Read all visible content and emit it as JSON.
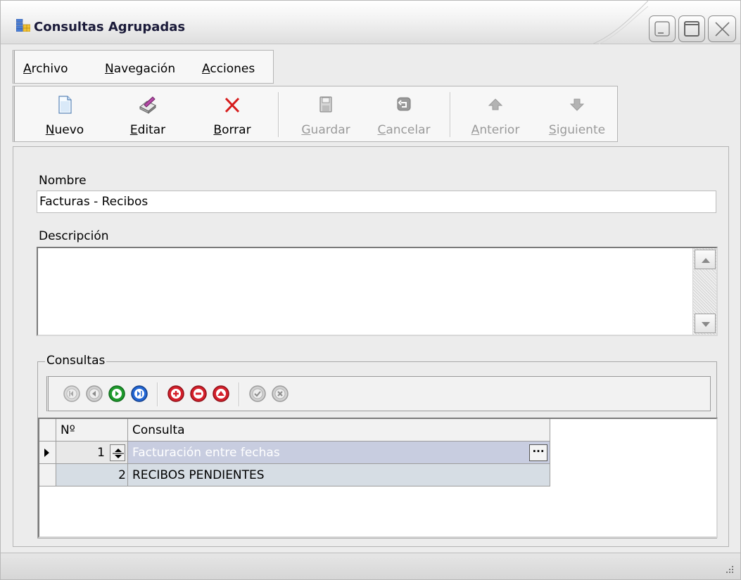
{
  "window": {
    "title": "Consultas Agrupadas"
  },
  "menu": {
    "items": [
      "Archivo",
      "Navegación",
      "Acciones"
    ]
  },
  "toolbar": {
    "nuevo": "Nuevo",
    "editar": "Editar",
    "borrar": "Borrar",
    "guardar": "Guardar",
    "cancelar": "Cancelar",
    "anterior": "Anterior",
    "siguiente": "Siguiente"
  },
  "form": {
    "nombre_label": "Nombre",
    "nombre_value": "Facturas - Recibos",
    "descripcion_label": "Descripción",
    "descripcion_value": ""
  },
  "consultas": {
    "group_title": "Consultas",
    "columns": [
      "Nº",
      "Consulta"
    ],
    "rows": [
      {
        "num": "1",
        "consulta": "Facturación entre fechas"
      },
      {
        "num": "2",
        "consulta": "RECIBOS PENDIENTES"
      }
    ],
    "ellipsis": "···"
  },
  "colors": {
    "nav_green": "#1e9b2c",
    "nav_blue": "#2367d4",
    "nav_red": "#d5202b",
    "borrar_red": "#d61b1b"
  },
  "icons": [
    "grid-icon",
    "minimize-icon",
    "maximize-icon",
    "close-icon",
    "new-document-icon",
    "edit-icon",
    "delete-icon",
    "save-icon",
    "cancel-icon",
    "arrow-up-icon",
    "arrow-down-icon"
  ]
}
